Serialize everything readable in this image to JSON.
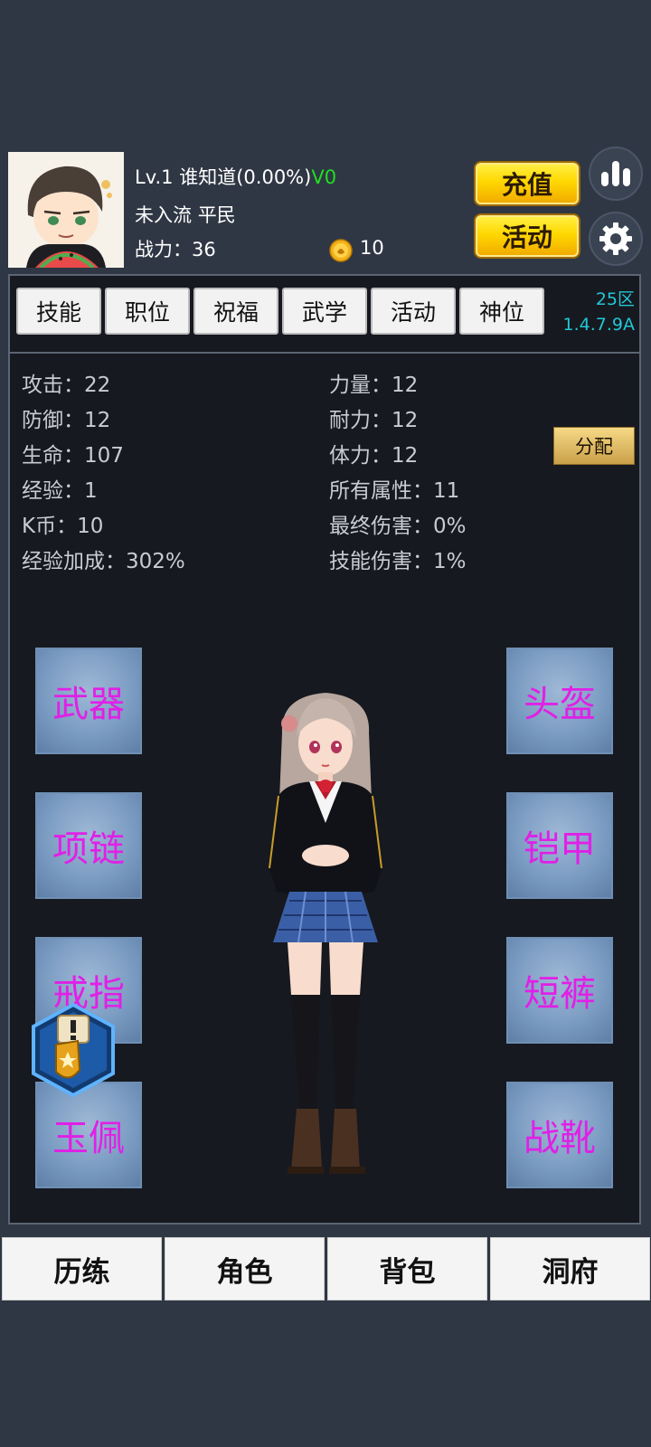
{
  "header": {
    "level": "Lv.1",
    "name": "谁知道(0.00%)",
    "vip": "V0",
    "sect": "未入流",
    "rank": "平民",
    "power_label": "战力：",
    "power_value": "36",
    "coins": "10",
    "recharge_label": "充值",
    "event_label": "活动"
  },
  "tabs": [
    "技能",
    "职位",
    "祝福",
    "武学",
    "活动",
    "神位"
  ],
  "server": {
    "zone": "25区",
    "version": "1.4.7.9A"
  },
  "stats": {
    "left": [
      {
        "label": "攻击：",
        "value": "22"
      },
      {
        "label": "防御：",
        "value": "12"
      },
      {
        "label": "生命：",
        "value": "107"
      },
      {
        "label": "经验：",
        "value": "1"
      },
      {
        "label": "K币：",
        "value": "10"
      },
      {
        "label": "经验加成：",
        "value": "302%"
      }
    ],
    "right": [
      {
        "label": "力量：",
        "value": "12"
      },
      {
        "label": "耐力：",
        "value": "12"
      },
      {
        "label": "体力：",
        "value": "12"
      },
      {
        "label": "所有属性：",
        "value": "11"
      },
      {
        "label": "最终伤害：",
        "value": "0%"
      },
      {
        "label": "技能伤害：",
        "value": "1%"
      }
    ]
  },
  "allocate_label": "分配",
  "equipment": {
    "left": [
      "武器",
      "项链",
      "戒指",
      "玉佩"
    ],
    "right": [
      "头盔",
      "铠甲",
      "短裤",
      "战靴"
    ]
  },
  "bottom_nav": [
    "历练",
    "角色",
    "背包",
    "洞府"
  ],
  "colors": {
    "background": "#2f3744",
    "panel": "#16191f",
    "vip": "#22dd22",
    "server": "#22c7d6",
    "slot_text": "#e020e6",
    "gold": "#ffd800"
  }
}
